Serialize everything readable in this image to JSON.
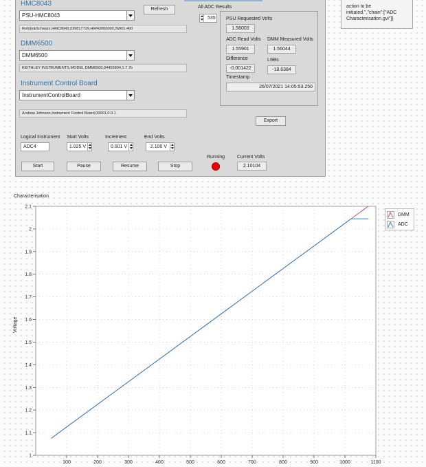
{
  "psu": {
    "title": "HMC8043",
    "selected": "PSU-HMC8043",
    "info": "Rohde&Schwarz,HMC8043,039817729,HW42000000,SW01.400",
    "refresh_label": "Refresh"
  },
  "dmm": {
    "title": "DMM6500",
    "selected": "DMM6500",
    "info": "KEITHLEY INSTRUMENTS,MODEL DMM6500,04455804,1.7.7b"
  },
  "icb": {
    "title": "Instrument Control Board",
    "selected": "InstrumentControlBoard",
    "info": "Andrew Johnson,Instrument Control Board,00001,0.0.1"
  },
  "adc": {
    "all_results_label": "All ADC Results",
    "index": "535",
    "psu_requested_label": "PSU Requested Volts",
    "psu_requested": "1.56003",
    "adc_read_label": "ADC Read Volts",
    "adc_read": "1.55901",
    "dmm_measured_label": "DMM Measured Volts",
    "dmm_measured": "1.56044",
    "difference_label": "Difference",
    "difference": "-0.001422",
    "lsbs_label": "LSBs",
    "lsbs": "-18.6384",
    "timestamp_label": "Timestamp",
    "timestamp": "26/07/2021 14:05:53.250",
    "export_label": "Export"
  },
  "controls": {
    "logical_label": "Logical Instrument",
    "logical": "ADC4",
    "start_volts_label": "Start Volts",
    "start_volts": "1.025 V",
    "increment_label": "Increment",
    "increment": "0.001 V",
    "end_volts_label": "End Volts",
    "end_volts": "2.100 V",
    "start": "Start",
    "pause": "Pause",
    "resume": "Resume",
    "stop": "Stop",
    "running_label": "Running",
    "current_volts_label": "Current Volts",
    "current_volts": "2.10104",
    "led_color": "#ee0000"
  },
  "note": {
    "lines": [
      "action to be",
      "initiated.\",\"chain\":[\"ADC",
      "Characterisation.gvi\"]}"
    ]
  },
  "colors": {
    "dmm": "#c0506e",
    "adc": "#2e86c1",
    "title": "#2a74ad"
  },
  "chart_data": {
    "type": "line",
    "title": "Characterisation",
    "xlabel": "",
    "ylabel": "Voltage",
    "xlim": [
      0,
      1100
    ],
    "ylim": [
      1.0,
      2.1
    ],
    "xticks": [
      100,
      200,
      300,
      400,
      500,
      600,
      700,
      800,
      900,
      1000,
      1100
    ],
    "yticks": [
      1,
      1.1,
      1.2,
      1.3,
      1.4,
      1.5,
      1.6,
      1.7,
      1.8,
      1.9,
      2,
      2.1
    ],
    "grid": true,
    "legend": "top-right",
    "series": [
      {
        "name": "DMM",
        "color": "#c0506e",
        "x": [
          50,
          300,
          600,
          900,
          1000,
          1076
        ],
        "y": [
          1.075,
          1.325,
          1.625,
          1.925,
          2.025,
          2.101
        ]
      },
      {
        "name": "ADC",
        "color": "#2e86c1",
        "x": [
          50,
          300,
          600,
          900,
          1000,
          1020,
          1076
        ],
        "y": [
          1.075,
          1.325,
          1.625,
          1.925,
          2.025,
          2.045,
          2.045
        ]
      }
    ]
  }
}
